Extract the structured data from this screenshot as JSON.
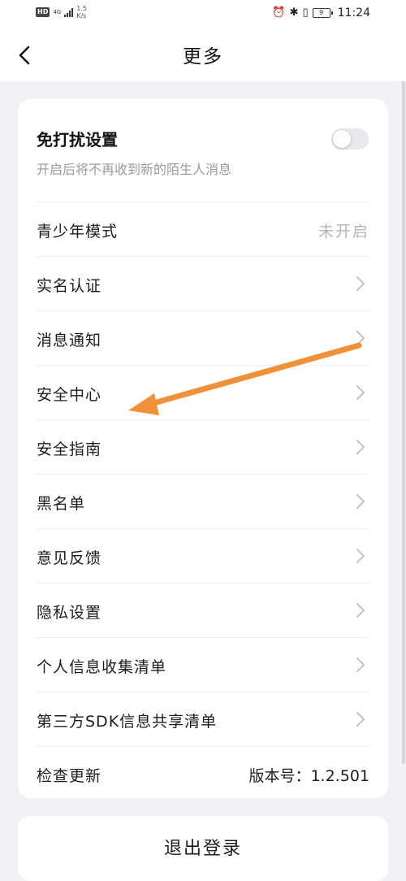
{
  "status_bar": {
    "network_badge": "HD",
    "network_type": "4G",
    "speed": "1.5",
    "speed_unit": "K/s",
    "battery": "9",
    "time": "11:24"
  },
  "header": {
    "title": "更多"
  },
  "do_not_disturb": {
    "title": "免打扰设置",
    "description": "开启后将不再收到新的陌生人消息",
    "enabled": false
  },
  "menu": {
    "items": [
      {
        "label": "青少年模式",
        "value": "未开启"
      },
      {
        "label": "实名认证"
      },
      {
        "label": "消息通知"
      },
      {
        "label": "安全中心"
      },
      {
        "label": "安全指南"
      },
      {
        "label": "黑名单"
      },
      {
        "label": "意见反馈"
      },
      {
        "label": "隐私设置"
      },
      {
        "label": "个人信息收集清单"
      },
      {
        "label": "第三方SDK信息共享清单"
      },
      {
        "label": "检查更新",
        "value": "版本号：1.2.501"
      }
    ]
  },
  "logout": {
    "label": "退出登录"
  },
  "annotation": {
    "arrow_color": "#f0913a"
  }
}
